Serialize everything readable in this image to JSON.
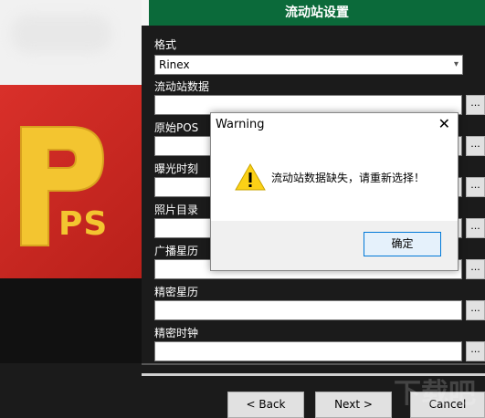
{
  "header": {
    "title": "流动站设置"
  },
  "form": {
    "format_label": "格式",
    "format_value": "Rinex",
    "fields": [
      {
        "label": "流动站数据"
      },
      {
        "label": "原始POS"
      },
      {
        "label": "曝光时刻"
      },
      {
        "label": "照片目录"
      },
      {
        "label": "广播星历"
      },
      {
        "label": "精密星历"
      },
      {
        "label": "精密时钟"
      }
    ],
    "browse_label": "..."
  },
  "nav": {
    "back": "< Back",
    "next": "Next >",
    "cancel": "Cancel"
  },
  "dialog": {
    "title": "Warning",
    "message": "流动站数据缺失，请重新选择！",
    "ok": "确定",
    "close": "✕"
  },
  "logo": {
    "text": "PS"
  },
  "watermark": "下载吧",
  "colors": {
    "header": "#0b6a3a",
    "logo_red": "#c9281f",
    "logo_gold": "#f3c530"
  }
}
